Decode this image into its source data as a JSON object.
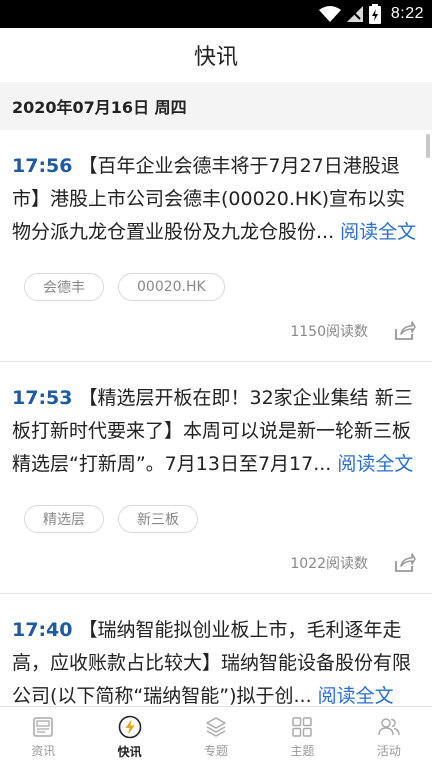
{
  "status_bar": {
    "time": "8:22",
    "icons": [
      "wifi-icon",
      "signal-icon",
      "battery-charging-icon"
    ]
  },
  "header": {
    "title": "快讯"
  },
  "date_header": "2020年07月16日 周四",
  "news": [
    {
      "time": "17:56",
      "text": "【百年企业会德丰将于7月27日港股退市】港股上市公司会德丰(00020.HK)宣布以实物分派九龙仓置业股份及九龙仓股份...",
      "read_more": "阅读全文",
      "tags": [
        "会德丰",
        "00020.HK"
      ],
      "read_count": "1150阅读数"
    },
    {
      "time": "17:53",
      "text": "【精选层开板在即！32家企业集结 新三板打新时代要来了】本周可以说是新一轮新三板精选层“打新周”。7月13日至7月17...",
      "read_more": "阅读全文",
      "tags": [
        "精选层",
        "新三板"
      ],
      "read_count": "1022阅读数"
    },
    {
      "time": "17:40",
      "text": "【瑞纳智能拟创业板上市，毛利逐年走高，应收账款占比较大】瑞纳智能设备股份有限公司(以下简称“瑞纳智能”)拟于创...",
      "read_more": "阅读全文",
      "tags": [],
      "read_count": ""
    }
  ],
  "tabs": [
    {
      "label": "资讯",
      "icon": "news-icon",
      "active": false
    },
    {
      "label": "快讯",
      "icon": "flash-icon",
      "active": true
    },
    {
      "label": "专题",
      "icon": "layers-icon",
      "active": false
    },
    {
      "label": "主题",
      "icon": "grid-icon",
      "active": false
    },
    {
      "label": "活动",
      "icon": "people-icon",
      "active": false
    }
  ],
  "colors": {
    "accent": "#2a6fcf",
    "time": "#1e5aa0",
    "active_tab_icon": "#e8a317"
  }
}
